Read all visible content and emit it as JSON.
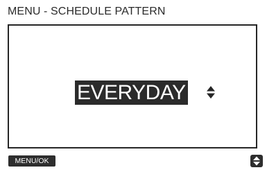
{
  "header": {
    "title": "MENU - SCHEDULE PATTERN"
  },
  "main": {
    "selected_value": "EVERYDAY",
    "selector_icon": "up-down-arrows-icon"
  },
  "footer": {
    "left_button_label": "MENU/OK",
    "right_button_icon": "up-down-arrows-icon"
  },
  "colors": {
    "foreground": "#262626",
    "background": "#ffffff",
    "highlight": "#2b2b2b"
  }
}
